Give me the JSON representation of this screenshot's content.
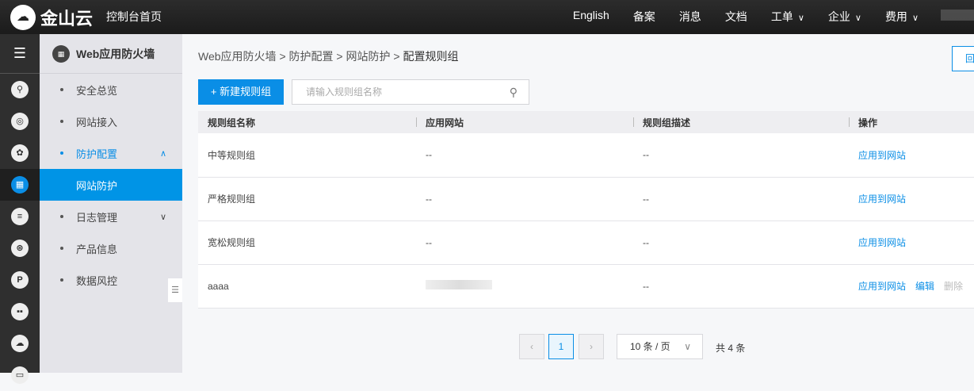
{
  "topbar": {
    "brand": "金山云",
    "home": "控制台首页",
    "nav": [
      {
        "label": "English"
      },
      {
        "label": "备案"
      },
      {
        "label": "消息"
      },
      {
        "label": "文档"
      },
      {
        "label": "工单",
        "dropdown": true
      },
      {
        "label": "企业",
        "dropdown": true
      },
      {
        "label": "费用",
        "dropdown": true
      }
    ]
  },
  "sidebar": {
    "title": "Web应用防火墙",
    "items": [
      {
        "label": "安全总览"
      },
      {
        "label": "网站接入"
      },
      {
        "label": "防护配置"
      },
      {
        "label": "网站防护"
      },
      {
        "label": "日志管理"
      },
      {
        "label": "产品信息"
      },
      {
        "label": "数据风控"
      }
    ]
  },
  "breadcrumb": [
    "Web应用防火墙",
    ">",
    "防护配置",
    ">",
    "网站防护",
    ">",
    "配置规则组"
  ],
  "back_button": "回",
  "toolbar": {
    "new_label": "新建规则组",
    "search_placeholder": "请输入规则组名称"
  },
  "table": {
    "headers": [
      "规则组名称",
      "应用网站",
      "规则组描述",
      "操作"
    ],
    "rows": [
      {
        "name": "中等规则组",
        "site": "--",
        "desc": "--",
        "actions": [
          "应用到网站"
        ]
      },
      {
        "name": "严格规则组",
        "site": "--",
        "desc": "--",
        "actions": [
          "应用到网站"
        ]
      },
      {
        "name": "宽松规则组",
        "site": "--",
        "desc": "--",
        "actions": [
          "应用到网站"
        ]
      },
      {
        "name": "aaaa",
        "site": "",
        "desc": "--",
        "actions": [
          "应用到网站",
          "编辑",
          "删除"
        ]
      }
    ]
  },
  "pagination": {
    "current": "1",
    "page_size": "10 条 / 页",
    "total": "共 4 条"
  }
}
